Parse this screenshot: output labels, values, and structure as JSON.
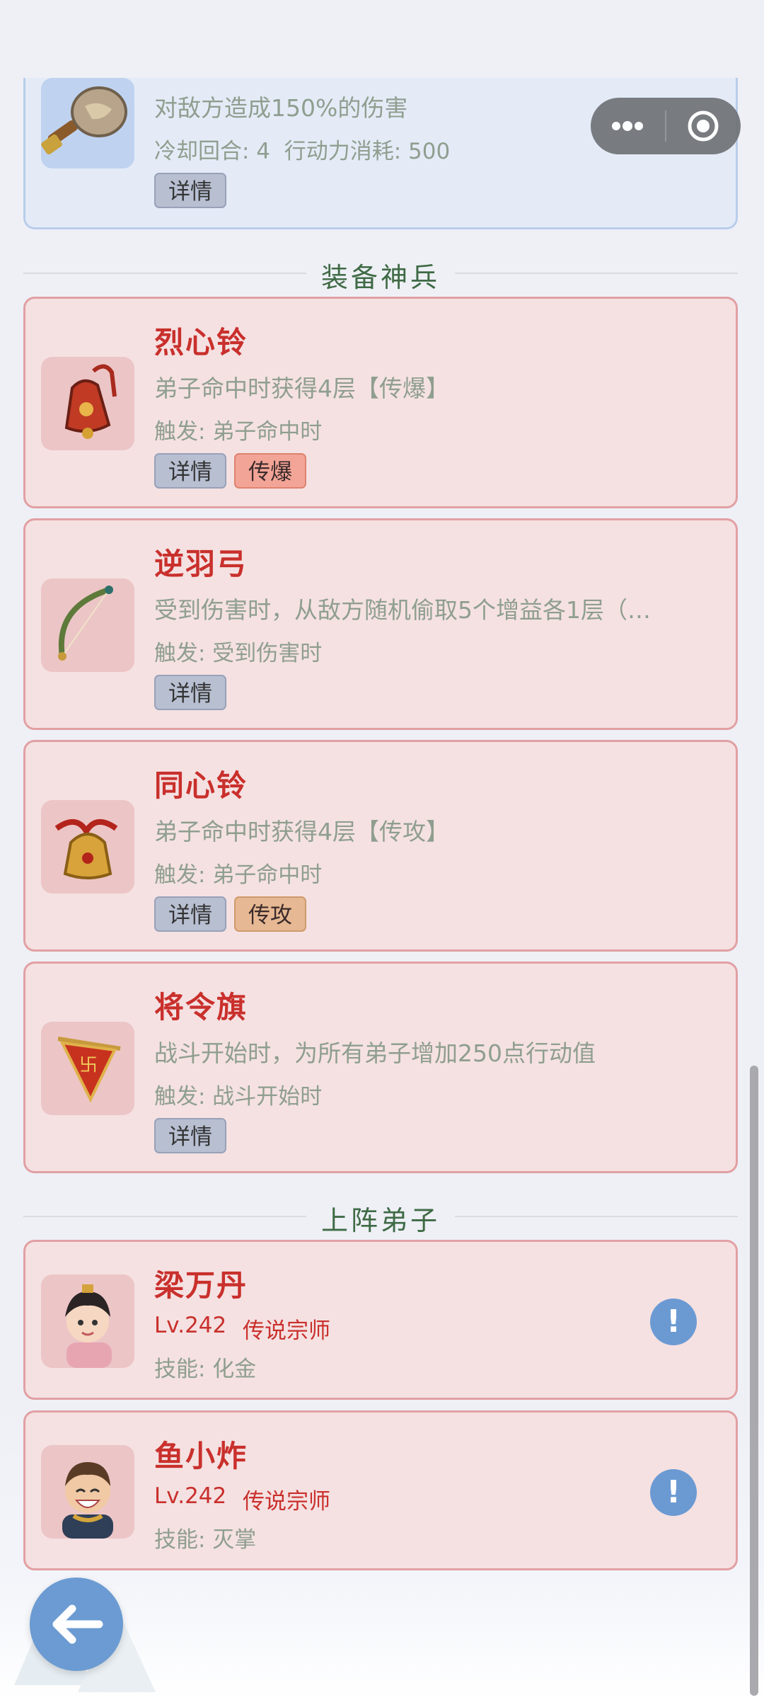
{
  "top_skill": {
    "desc": "对敌方造成150%的伤害",
    "cooldown_line": "冷却回合: 4  行动力消耗: 500",
    "detail_label": "详情",
    "icon": "hammer-icon"
  },
  "mini_program_capsule": {
    "more_icon": "more-dots-icon",
    "close_icon": "target-close-icon"
  },
  "equipment_section": {
    "title": "装备神兵",
    "items": [
      {
        "name": "烈心铃",
        "desc": "弟子命中时获得4层【传爆】",
        "trigger": "触发: 弟子命中时",
        "detail_label": "详情",
        "tag": "传爆",
        "icon": "red-bell-icon"
      },
      {
        "name": "逆羽弓",
        "desc": "受到伤害时，从敌方随机偷取5个增益各1层（…",
        "trigger": "触发: 受到伤害时",
        "detail_label": "详情",
        "tag": "",
        "icon": "bow-icon"
      },
      {
        "name": "同心铃",
        "desc": "弟子命中时获得4层【传攻】",
        "trigger": "触发: 弟子命中时",
        "detail_label": "详情",
        "tag": "传攻",
        "icon": "golden-bell-icon"
      },
      {
        "name": "将令旗",
        "desc": "战斗开始时，为所有弟子增加250点行动值",
        "trigger": "触发: 战斗开始时",
        "detail_label": "详情",
        "tag": "",
        "icon": "flag-icon"
      }
    ]
  },
  "disciples_section": {
    "title": "上阵弟子",
    "items": [
      {
        "name": "梁万丹",
        "level": "Lv.242",
        "rank": "传说宗师",
        "skill": "技能: 化金",
        "alert": "!",
        "icon": "female-avatar-icon"
      },
      {
        "name": "鱼小炸",
        "level": "Lv.242",
        "rank": "传说宗师",
        "skill": "技能: 灭掌",
        "alert": "!",
        "icon": "male-avatar-icon"
      }
    ]
  },
  "back_button": {
    "icon": "arrow-left-icon"
  },
  "colors": {
    "title_red": "#c9302c",
    "card_bg": "#f5e1e2",
    "card_border": "#e2a0a3",
    "accent_blue": "#6b9bd2"
  }
}
